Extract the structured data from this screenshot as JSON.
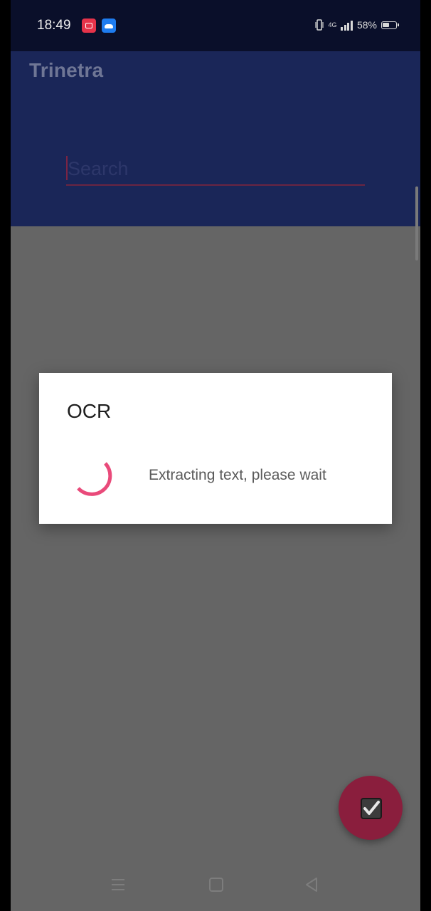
{
  "status_bar": {
    "time": "18:49",
    "signal_label": "4G",
    "battery_percent": "58%",
    "icons": [
      "screen-record-icon",
      "cloud-app-icon",
      "vibrate-icon",
      "signal-icon",
      "battery-icon"
    ]
  },
  "app_bar": {
    "title": "Trinetra"
  },
  "search": {
    "placeholder": "Search"
  },
  "dialog": {
    "title": "OCR",
    "message": "Extracting text, please wait"
  },
  "fab": {
    "icon": "check-icon"
  },
  "nav_bar": {
    "icons": [
      "menu-icon",
      "home-icon",
      "back-icon"
    ]
  },
  "colors": {
    "status_bar": "#0A0F2A",
    "app_bar_dimmed": "#1A2658",
    "scrim_content": "#656565",
    "accent_pink": "#E94A7A",
    "fab_dimmed": "#8A1E3D",
    "dialog_bg": "#FFFFFF"
  }
}
